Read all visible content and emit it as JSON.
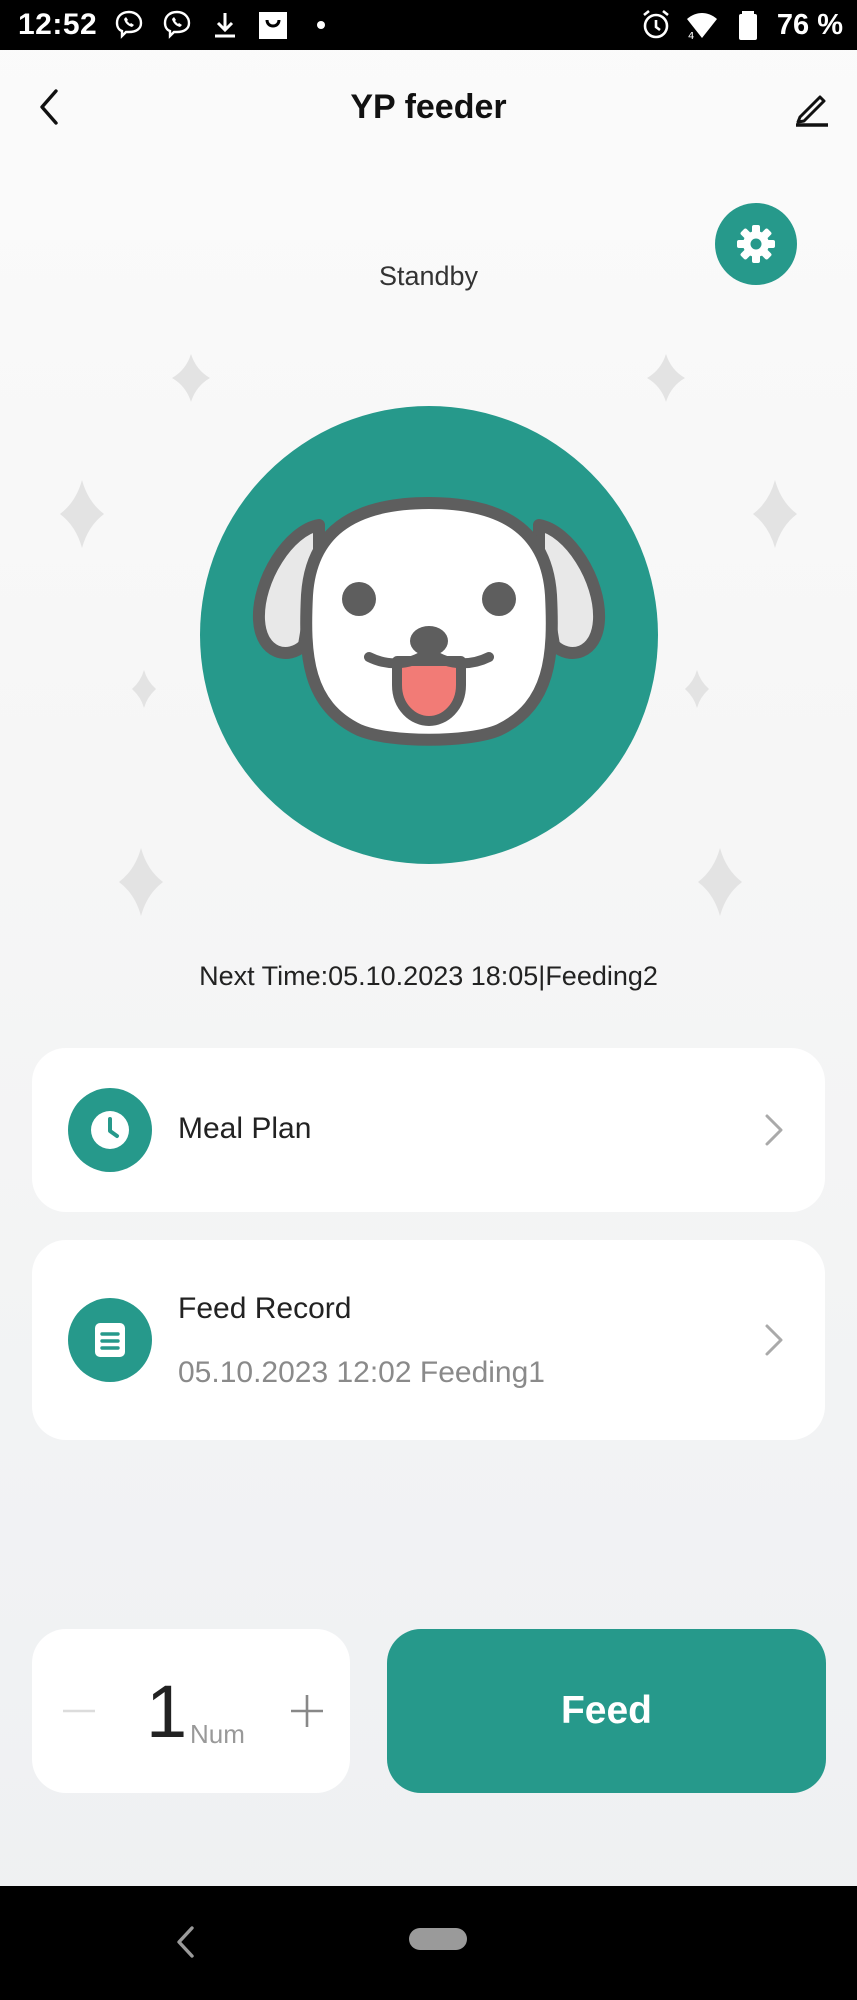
{
  "status_bar": {
    "time": "12:52",
    "battery": "76 %",
    "icons_left": [
      "viber-icon",
      "viber-icon",
      "download-icon",
      "shopping-bag-icon",
      "dot-icon"
    ],
    "icons_right": [
      "alarm-icon",
      "wifi-icon",
      "battery-icon"
    ]
  },
  "header": {
    "title": "YP feeder",
    "back_icon": "back-arrow-icon",
    "edit_icon": "edit-pencil-icon"
  },
  "device": {
    "status": "Standby",
    "settings_icon": "gear-icon",
    "avatar_icon": "dog-face-icon",
    "next_time": "Next Time:05.10.2023 18:05|Feeding2"
  },
  "menu": {
    "meal_plan": {
      "label": "Meal Plan",
      "icon": "clock-icon"
    },
    "feed_record": {
      "label": "Feed Record",
      "detail": "05.10.2023 12:02 Feeding1",
      "icon": "document-icon"
    }
  },
  "stepper": {
    "value": "1",
    "unit": "Num"
  },
  "feed_button": {
    "label": "Feed"
  },
  "colors": {
    "accent": "#26998b",
    "background": "#f5f5f5",
    "card": "#ffffff"
  }
}
